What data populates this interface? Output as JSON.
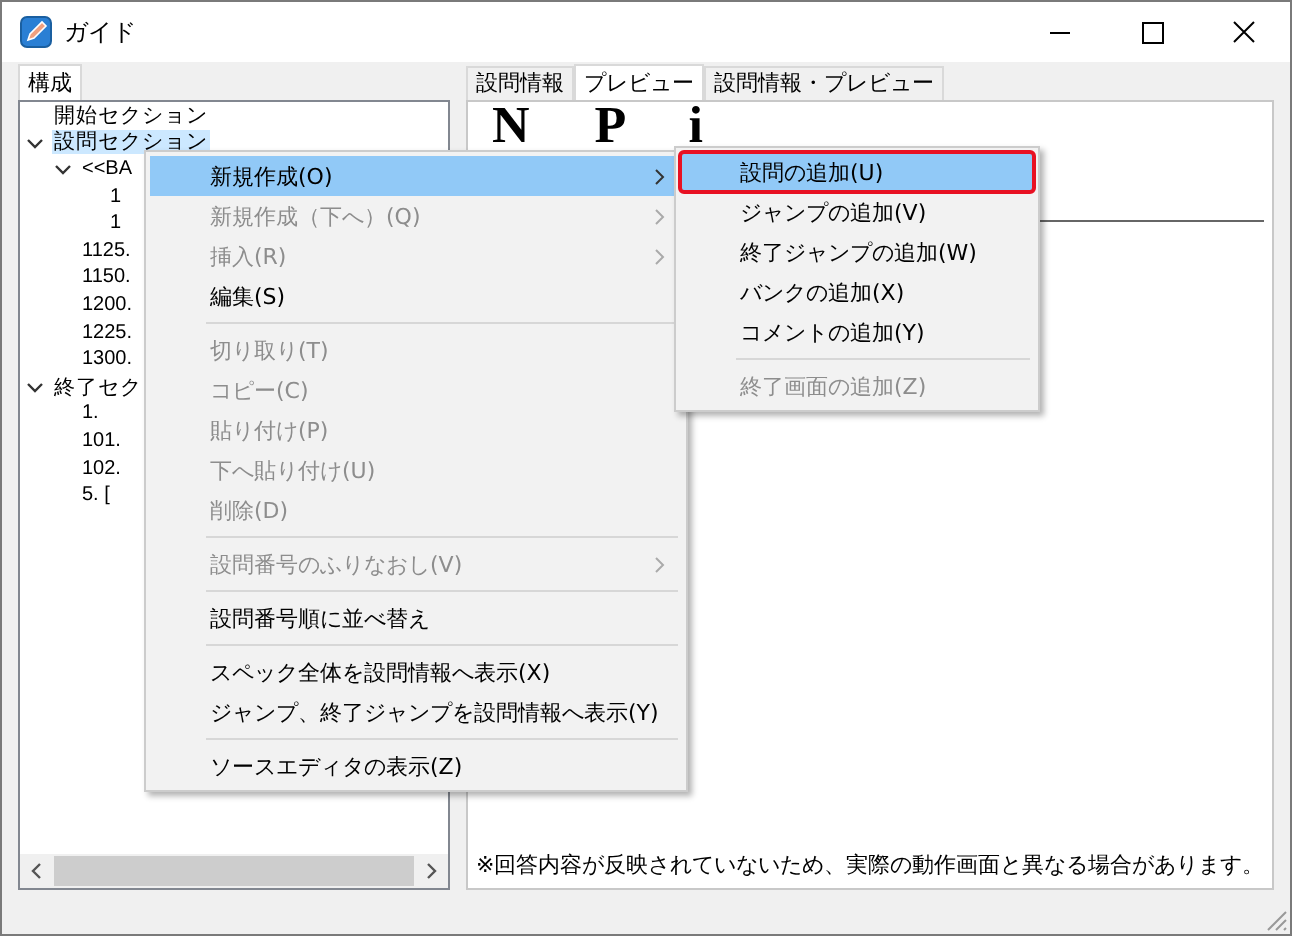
{
  "window": {
    "title": "ガイド"
  },
  "left_tabs": [
    {
      "label": "構成",
      "selected": true
    }
  ],
  "tree": [
    {
      "label": "開始セクション",
      "selected": false
    },
    {
      "label": "設問セクション",
      "selected": true,
      "expanded": true,
      "children": [
        {
          "label": "<<BA",
          "selected": false,
          "expanded": true,
          "children": [
            {
              "label": "1",
              "selected": false
            },
            {
              "label": "1",
              "selected": false
            }
          ]
        },
        {
          "label": "1125.",
          "selected": false
        },
        {
          "label": "1150.",
          "selected": false
        },
        {
          "label": "1200.",
          "selected": false
        },
        {
          "label": "1225.",
          "selected": false
        },
        {
          "label": "1300.",
          "selected": false
        }
      ]
    },
    {
      "label": "終了セク",
      "selected": false,
      "expanded": true,
      "children": [
        {
          "label": "1.",
          "selected": false
        },
        {
          "label": "101.",
          "selected": false
        },
        {
          "label": "102.",
          "selected": false
        },
        {
          "label": "5. [",
          "selected": false
        }
      ]
    }
  ],
  "right_tabs": [
    {
      "label": "設問情報",
      "selected": false
    },
    {
      "label": "プレビュー",
      "selected": true
    },
    {
      "label": "設問情報・プレビュー",
      "selected": false
    }
  ],
  "preview": {
    "heading": "N P i",
    "note": "※回答内容が反映されていないため、実際の動作画面と異なる場合があります。"
  },
  "context_menu": {
    "items": [
      {
        "kind": "item",
        "label": "新規作成(O)",
        "disabled": false,
        "submenu": true,
        "selected": true
      },
      {
        "kind": "item",
        "label": "新規作成（下へ）(Q)",
        "disabled": true,
        "submenu": true,
        "selected": false
      },
      {
        "kind": "item",
        "label": "挿入(R)",
        "disabled": true,
        "submenu": true,
        "selected": false
      },
      {
        "kind": "item",
        "label": "編集(S)",
        "disabled": false,
        "submenu": false,
        "selected": false
      },
      {
        "kind": "separator"
      },
      {
        "kind": "item",
        "label": "切り取り(T)",
        "disabled": true,
        "submenu": false,
        "selected": false
      },
      {
        "kind": "item",
        "label": "コピー(C)",
        "disabled": true,
        "submenu": false,
        "selected": false
      },
      {
        "kind": "item",
        "label": "貼り付け(P)",
        "disabled": true,
        "submenu": false,
        "selected": false
      },
      {
        "kind": "item",
        "label": "下へ貼り付け(U)",
        "disabled": true,
        "submenu": false,
        "selected": false
      },
      {
        "kind": "item",
        "label": "削除(D)",
        "disabled": true,
        "submenu": false,
        "selected": false
      },
      {
        "kind": "separator"
      },
      {
        "kind": "item",
        "label": "設問番号のふりなおし(V)",
        "disabled": true,
        "submenu": true,
        "selected": false
      },
      {
        "kind": "separator"
      },
      {
        "kind": "item",
        "label": "設問番号順に並べ替え",
        "disabled": false,
        "submenu": false,
        "selected": false
      },
      {
        "kind": "separator"
      },
      {
        "kind": "item",
        "label": "スペック全体を設問情報へ表示(X)",
        "disabled": false,
        "submenu": false,
        "selected": false
      },
      {
        "kind": "item",
        "label": "ジャンプ、終了ジャンプを設問情報へ表示(Y)",
        "disabled": false,
        "submenu": false,
        "selected": false
      },
      {
        "kind": "separator"
      },
      {
        "kind": "item",
        "label": "ソースエディタの表示(Z)",
        "disabled": false,
        "submenu": false,
        "selected": false
      }
    ]
  },
  "submenu": {
    "items": [
      {
        "kind": "item",
        "label": "設問の追加(U)",
        "disabled": false,
        "selected": true,
        "outlined": true
      },
      {
        "kind": "item",
        "label": "ジャンプの追加(V)",
        "disabled": false,
        "selected": false,
        "outlined": false
      },
      {
        "kind": "item",
        "label": "終了ジャンプの追加(W)",
        "disabled": false,
        "selected": false,
        "outlined": false
      },
      {
        "kind": "item",
        "label": "バンクの追加(X)",
        "disabled": false,
        "selected": false,
        "outlined": false
      },
      {
        "kind": "item",
        "label": "コメントの追加(Y)",
        "disabled": false,
        "selected": false,
        "outlined": false
      },
      {
        "kind": "separator"
      },
      {
        "kind": "item",
        "label": "終了画面の追加(Z)",
        "disabled": true,
        "selected": false,
        "outlined": false
      }
    ]
  }
}
